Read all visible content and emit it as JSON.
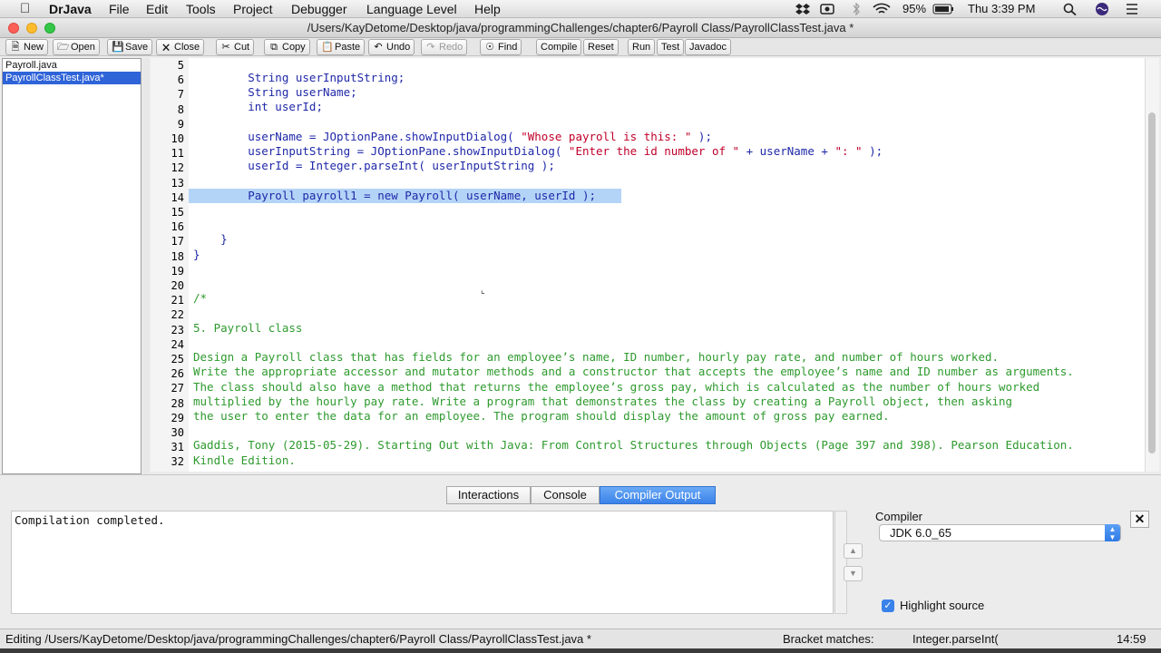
{
  "menubar": {
    "apple_icon": "apple-icon",
    "app_name": "DrJava",
    "items": [
      "File",
      "Edit",
      "Tools",
      "Project",
      "Debugger",
      "Language Level",
      "Help"
    ],
    "battery": "95%",
    "clock": "Thu 3:39 PM"
  },
  "window": {
    "title": "/Users/KayDetome/Desktop/java/programmingChallenges/chapter6/Payroll Class/PayrollClassTest.java *"
  },
  "toolbar": {
    "new": "New",
    "open": "Open",
    "save": "Save",
    "close": "Close",
    "cut": "Cut",
    "copy": "Copy",
    "paste": "Paste",
    "undo": "Undo",
    "redo": "Redo",
    "find": "Find",
    "compile": "Compile",
    "reset": "Reset",
    "run": "Run",
    "test": "Test",
    "javadoc": "Javadoc"
  },
  "files": [
    "Payroll.java",
    "PayrollClassTest.java*"
  ],
  "editor": {
    "line_numbers": [
      "5",
      "6",
      "7",
      "8",
      "9",
      "10",
      "11",
      "12",
      "13",
      "14",
      "15",
      "16",
      "17",
      "18",
      "19",
      "20",
      "21",
      "22",
      "23",
      "24",
      "25",
      "26",
      "27",
      "28",
      "29",
      "30",
      "31",
      "32"
    ],
    "code": {
      "l6": "        String userInputString;",
      "l7": "        String userName;",
      "l8": "        int userId;",
      "l10a": "        userName = JOptionPane.showInputDialog( ",
      "l10s": "\"Whose payroll is this: \"",
      "l10b": " );",
      "l11a": "        userInputString = JOptionPane.showInputDialog( ",
      "l11s1": "\"Enter the id number of \"",
      "l11b": " + userName + ",
      "l11s2": "\": \"",
      "l11c": " );",
      "l12": "        userId = Integer.parseInt( userInputString );",
      "l14": "        Payroll payroll1 = new Payroll( userName, userId );",
      "l17": "    }",
      "l18": "}",
      "l21": "/*",
      "l23": "5. Payroll class",
      "l25": "Design a Payroll class that has fields for an employee’s name, ID number, hourly pay rate, and number of hours worked.",
      "l26": "Write the appropriate accessor and mutator methods and a constructor that accepts the employee’s name and ID number as arguments.",
      "l27": "The class should also have a method that returns the employee’s gross pay, which is calculated as the number of hours worked",
      "l28": "multiplied by the hourly pay rate. Write a program that demonstrates the class by creating a Payroll object, then asking",
      "l29": "the user to enter the data for an employee. The program should display the amount of gross pay earned.",
      "l31": "Gaddis, Tony (2015-05-29). Starting Out with Java: From Control Structures through Objects (Page 397 and 398). Pearson Education.",
      "l32": "Kindle Edition."
    }
  },
  "tabs": [
    "Interactions",
    "Console",
    "Compiler Output"
  ],
  "active_tab": "Compiler Output",
  "output": "Compilation completed.",
  "compiler": {
    "label": "Compiler",
    "selected": "JDK 6.0_65",
    "highlight_label": "Highlight source",
    "highlight_checked": true
  },
  "status": {
    "editing": "Editing /Users/KayDetome/Desktop/java/programmingChallenges/chapter6/Payroll Class/PayrollClassTest.java *",
    "bracket_label": "Bracket matches:",
    "bracket_value": "Integer.parseInt(",
    "position": "14:59"
  },
  "colors": {
    "selection": "#2f64d8",
    "highlight_line": "#b4d4f7",
    "comment": "#2e9a2e",
    "string": "#c0002a",
    "code": "#1f28a8"
  }
}
